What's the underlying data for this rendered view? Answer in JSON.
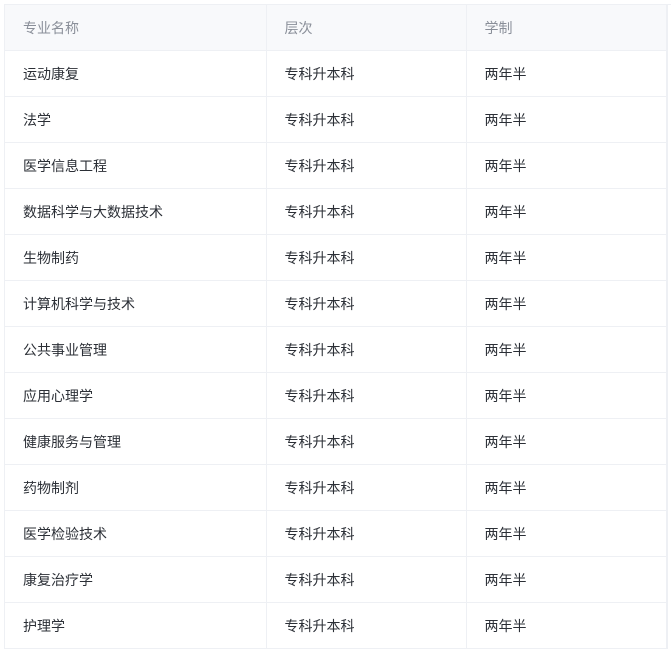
{
  "table": {
    "headers": [
      "专业名称",
      "层次",
      "学制"
    ],
    "rows": [
      [
        "运动康复",
        "专科升本科",
        "两年半"
      ],
      [
        "法学",
        "专科升本科",
        "两年半"
      ],
      [
        "医学信息工程",
        "专科升本科",
        "两年半"
      ],
      [
        "数据科学与大数据技术",
        "专科升本科",
        "两年半"
      ],
      [
        "生物制药",
        "专科升本科",
        "两年半"
      ],
      [
        "计算机科学与技术",
        "专科升本科",
        "两年半"
      ],
      [
        "公共事业管理",
        "专科升本科",
        "两年半"
      ],
      [
        "应用心理学",
        "专科升本科",
        "两年半"
      ],
      [
        "健康服务与管理",
        "专科升本科",
        "两年半"
      ],
      [
        "药物制剂",
        "专科升本科",
        "两年半"
      ],
      [
        "医学检验技术",
        "专科升本科",
        "两年半"
      ],
      [
        "康复治疗学",
        "专科升本科",
        "两年半"
      ],
      [
        "护理学",
        "专科升本科",
        "两年半"
      ]
    ]
  }
}
